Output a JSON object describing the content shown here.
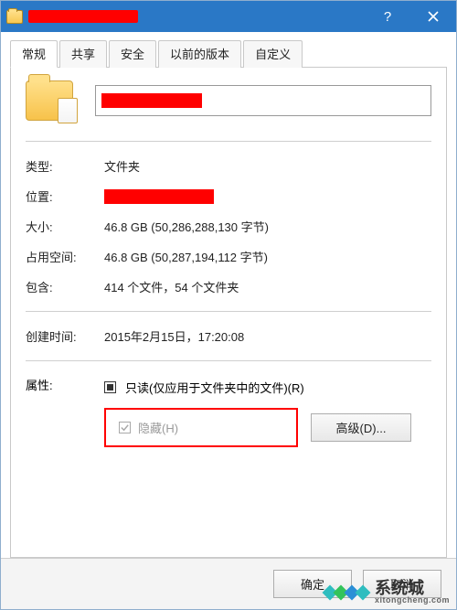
{
  "titlebar": {
    "title_redacted": true
  },
  "tabs": {
    "general": "常规",
    "sharing": "共享",
    "security": "安全",
    "previous": "以前的版本",
    "customize": "自定义"
  },
  "general": {
    "type_label": "类型:",
    "type_value": "文件夹",
    "location_label": "位置:",
    "size_label": "大小:",
    "size_value": "46.8 GB (50,286,288,130 字节)",
    "size_on_disk_label": "占用空间:",
    "size_on_disk_value": "46.8 GB (50,287,194,112 字节)",
    "contains_label": "包含:",
    "contains_value": "414 个文件，54 个文件夹",
    "created_label": "创建时间:",
    "created_value": "2015年2月15日，17:20:08",
    "attributes_label": "属性:",
    "readonly_label": "只读(仅应用于文件夹中的文件)(R)",
    "hidden_label": "隐藏(H)",
    "advanced_button": "高级(D)..."
  },
  "buttons": {
    "ok": "确定",
    "cancel": "取消"
  },
  "watermark": {
    "main": "系统城",
    "sub": "xitongcheng.com"
  }
}
